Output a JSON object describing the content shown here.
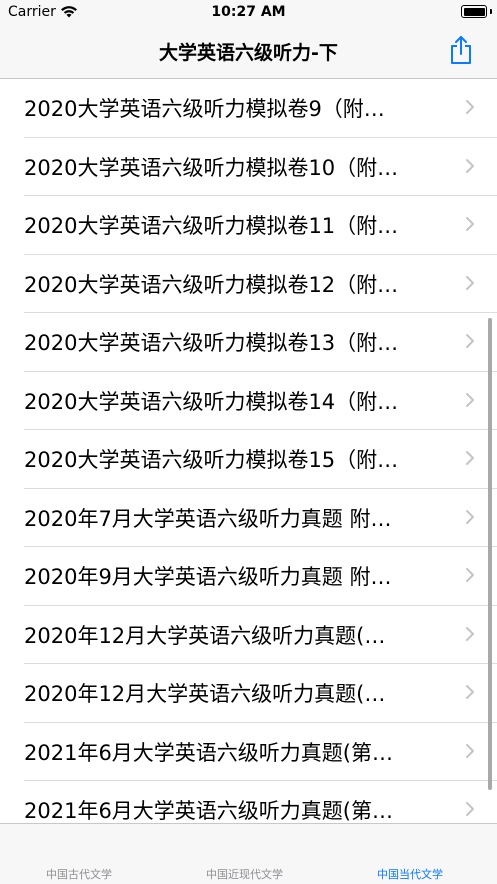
{
  "status_bar": {
    "carrier": "Carrier",
    "time": "10:27 AM"
  },
  "nav": {
    "title": "大学英语六级听力-下",
    "share_icon": "share-icon"
  },
  "list": {
    "items": [
      "2020大学英语六级听力模拟卷9（附…",
      "2020大学英语六级听力模拟卷10（附…",
      "2020大学英语六级听力模拟卷11（附…",
      "2020大学英语六级听力模拟卷12（附…",
      "2020大学英语六级听力模拟卷13（附…",
      "2020大学英语六级听力模拟卷14（附…",
      "2020大学英语六级听力模拟卷15（附…",
      "2020年7月大学英语六级听力真题 附…",
      "2020年9月大学英语六级听力真题 附…",
      "2020年12月大学英语六级听力真题(…",
      "2020年12月大学英语六级听力真题(…",
      "2021年6月大学英语六级听力真题(第…",
      "2021年6月大学英语六级听力真题(第…"
    ]
  },
  "tabs": [
    {
      "label": "中国古代文学",
      "active": false
    },
    {
      "label": "中国近现代文学",
      "active": false
    },
    {
      "label": "中国当代文学",
      "active": true
    }
  ],
  "colors": {
    "accent": "#0a7aff",
    "inactive": "#8e8e93"
  }
}
